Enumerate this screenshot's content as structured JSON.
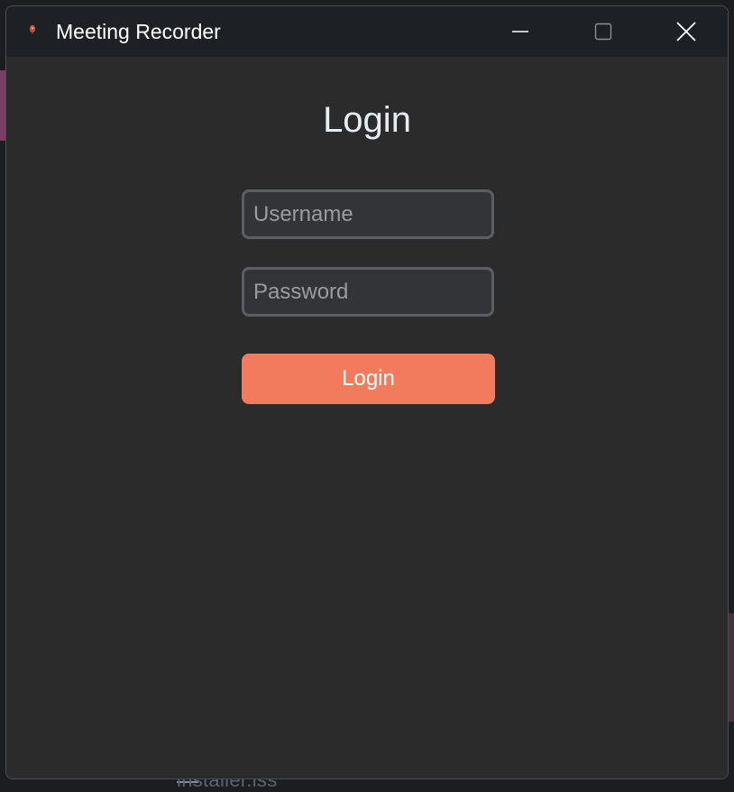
{
  "window": {
    "title": "Meeting Recorder",
    "app_icon": "app-logo-icon",
    "controls": [
      "minimize-icon",
      "maximize-icon",
      "close-icon"
    ]
  },
  "login": {
    "heading": "Login",
    "username_placeholder": "Username",
    "username_value": "",
    "password_placeholder": "Password",
    "password_value": "",
    "button_label": "Login"
  },
  "background": {
    "partial_text": "installer.iss"
  },
  "colors": {
    "accent": "#f17b5c",
    "window_bg": "#2b2b2b",
    "titlebar_bg": "#1d2024",
    "field_border": "#5c5f63"
  }
}
